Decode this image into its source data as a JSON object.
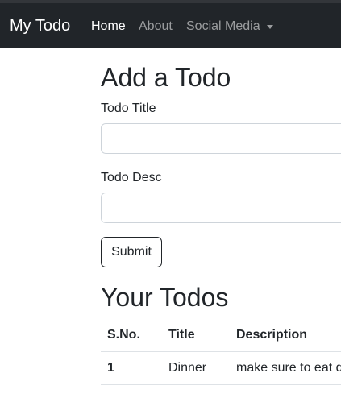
{
  "navbar": {
    "brand": "My Todo",
    "links": [
      {
        "label": "Home",
        "active": true
      },
      {
        "label": "About",
        "active": false
      },
      {
        "label": "Social Media",
        "active": false,
        "dropdown": true
      }
    ],
    "dropdown_icon": "caret-down-icon",
    "background": "#212529"
  },
  "form": {
    "heading": "Add a Todo",
    "title_label": "Todo Title",
    "title_value": "",
    "desc_label": "Todo Desc",
    "desc_value": "",
    "submit_label": "Submit"
  },
  "todos": {
    "heading": "Your Todos",
    "columns": [
      "S.No.",
      "Title",
      "Description"
    ],
    "rows": [
      {
        "sno": "1",
        "title": "Dinner",
        "description": "make sure to eat d"
      }
    ]
  }
}
